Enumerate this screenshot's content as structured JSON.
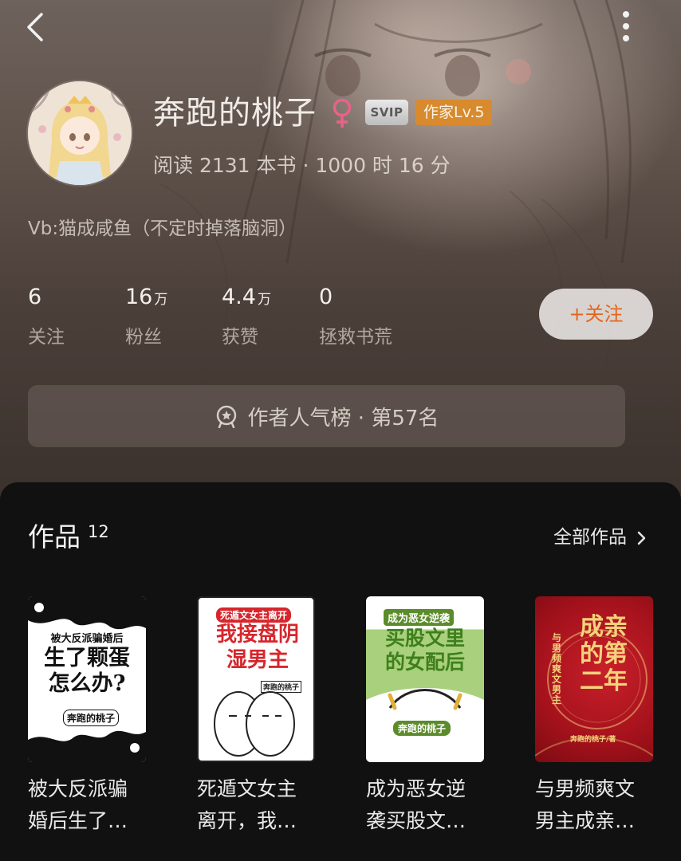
{
  "header": {
    "back_icon": "chevron-left-icon",
    "more_icon": "more-vertical-icon"
  },
  "profile": {
    "name": "奔跑的桃子",
    "gender_icon": "female-icon",
    "svip_label": "SVIP",
    "level_label": "作家Lv.5",
    "reading_stats": "阅读 2131 本书 · 1000 时 16 分",
    "bio": "Vb:猫成咸鱼（不定时掉落脑洞）"
  },
  "stats": [
    {
      "value": "6",
      "unit": "",
      "label": "关注"
    },
    {
      "value": "16",
      "unit": "万",
      "label": "粉丝"
    },
    {
      "value": "4.4",
      "unit": "万",
      "label": "获赞"
    },
    {
      "value": "0",
      "unit": "",
      "label": "拯救书荒"
    }
  ],
  "follow_button": {
    "label": "+关注"
  },
  "rank": {
    "icon": "medal-icon",
    "text": "作者人气榜 · 第57名"
  },
  "works": {
    "title": "作品",
    "count": "12",
    "all_label": "全部作品",
    "books": [
      {
        "title": "被大反派骗婚后生了…",
        "cover_small": "被大反派骗婚后",
        "cover_main": "生了颗蛋怎么办?",
        "cover_author": "奔跑的桃子"
      },
      {
        "title": "死遁文女主离开，我…",
        "cover_small": "死遁文女主离开",
        "cover_main": "我接盘阴湿男主",
        "cover_author": "奔跑的桃子"
      },
      {
        "title": "成为恶女逆袭买股文…",
        "cover_small": "成为恶女逆袭",
        "cover_main": "买股文里的女配后",
        "cover_author": "奔跑的桃子"
      },
      {
        "title": "与男频爽文男主成亲…",
        "cover_small": "与男频爽文男主",
        "cover_main": "成亲的第二年",
        "cover_author": "奔跑的桃子/著"
      }
    ]
  }
}
